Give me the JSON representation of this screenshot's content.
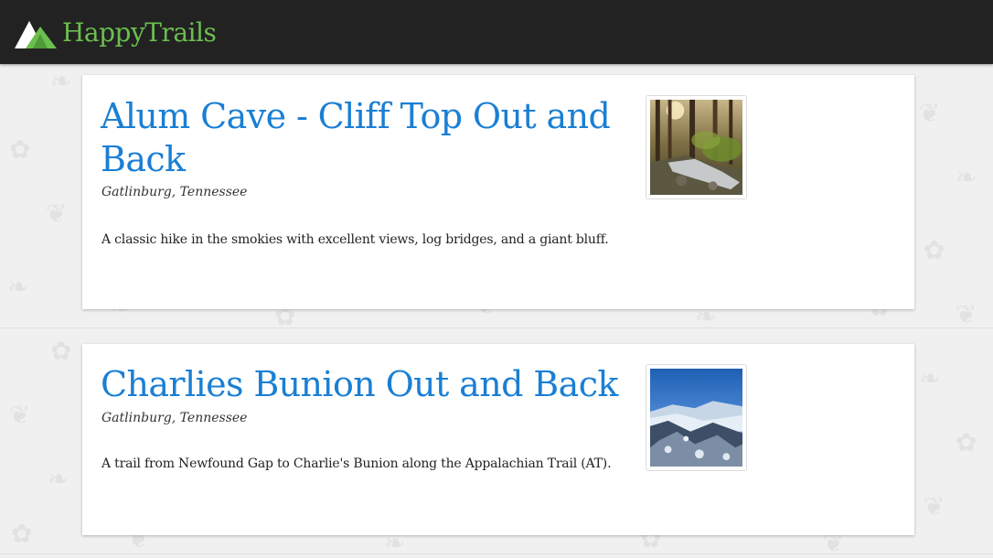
{
  "navbar": {
    "brand_name": "HappyTrails",
    "brand_color": "#6bbf4f",
    "logo_icon": "mountain-icon"
  },
  "trails": [
    {
      "title": "Alum Cave - Cliff Top Out and Back",
      "location": "Gatlinburg, Tennessee",
      "description": "A classic hike in the smokies with excellent views, log bridges, and a giant bluff.",
      "image": "forest-stream-photo"
    },
    {
      "title": "Charlies Bunion Out and Back",
      "location": "Gatlinburg, Tennessee",
      "description": "A trail from Newfound Gap to Charlie's Bunion along the Appalachian Trail (AT).",
      "image": "snowy-mountain-photo"
    }
  ],
  "colors": {
    "title_link": "#1a7fd4",
    "navbar_bg": "#222222",
    "page_bg": "#f0f0f0"
  }
}
